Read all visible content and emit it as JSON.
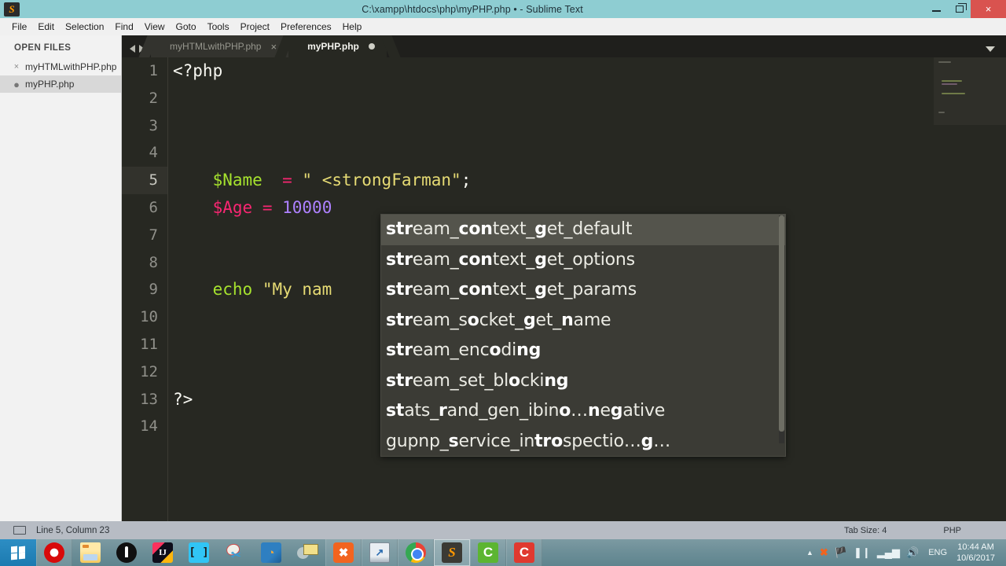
{
  "window": {
    "title": "C:\\xampp\\htdocs\\php\\myPHP.php • - Sublime Text",
    "app_icon": "S",
    "controls": {
      "minimize": "minimize-icon",
      "maximize": "restore-icon",
      "close": "×"
    }
  },
  "menubar": {
    "items": [
      "File",
      "Edit",
      "Selection",
      "Find",
      "View",
      "Goto",
      "Tools",
      "Project",
      "Preferences",
      "Help"
    ]
  },
  "sidebar": {
    "header": "OPEN FILES",
    "items": [
      {
        "label": "myHTMLwithPHP.php",
        "icon": "×",
        "active": false
      },
      {
        "label": "myPHP.php",
        "icon": "●",
        "active": true
      }
    ]
  },
  "tabs": {
    "nav_prev": "◀",
    "nav_next": "▶",
    "items": [
      {
        "label": "myHTMLwithPHP.php",
        "active": false,
        "dirty": false,
        "close": "×"
      },
      {
        "label": "myPHP.php",
        "active": true,
        "dirty": true
      }
    ],
    "overflow_menu": "chevron-down-icon"
  },
  "editor": {
    "line_numbers": [
      "1",
      "2",
      "3",
      "4",
      "5",
      "6",
      "7",
      "8",
      "9",
      "10",
      "11",
      "12",
      "13",
      "14"
    ],
    "current_line": 5,
    "lines": [
      {
        "n": 1,
        "tokens": [
          {
            "t": "<?php",
            "c": "tok-tag"
          }
        ]
      },
      {
        "n": 2,
        "tokens": []
      },
      {
        "n": 3,
        "tokens": []
      },
      {
        "n": 4,
        "tokens": []
      },
      {
        "n": 5,
        "tokens": [
          {
            "t": "    ",
            "c": "tok-punc"
          },
          {
            "t": "$Name",
            "c": "tok-var"
          },
          {
            "t": "  ",
            "c": "tok-punc"
          },
          {
            "t": "=",
            "c": "tok-op"
          },
          {
            "t": " ",
            "c": "tok-punc"
          },
          {
            "t": "\" <strongFarman\"",
            "c": "tok-str"
          },
          {
            "t": ";",
            "c": "tok-punc"
          }
        ]
      },
      {
        "n": 6,
        "tokens": [
          {
            "t": "    ",
            "c": "tok-punc"
          },
          {
            "t": "$Age",
            "c": "tok-var2"
          },
          {
            "t": " ",
            "c": "tok-punc"
          },
          {
            "t": "=",
            "c": "tok-op"
          },
          {
            "t": " ",
            "c": "tok-punc"
          },
          {
            "t": "10000",
            "c": "tok-num"
          }
        ]
      },
      {
        "n": 7,
        "tokens": []
      },
      {
        "n": 8,
        "tokens": []
      },
      {
        "n": 9,
        "tokens": [
          {
            "t": "    ",
            "c": "tok-punc"
          },
          {
            "t": "echo",
            "c": "tok-kw"
          },
          {
            "t": " ",
            "c": "tok-punc"
          },
          {
            "t": "\"My nam",
            "c": "tok-str"
          }
        ]
      },
      {
        "n": 10,
        "tokens": []
      },
      {
        "n": 11,
        "tokens": []
      },
      {
        "n": 12,
        "tokens": []
      },
      {
        "n": 13,
        "tokens": [
          {
            "t": "?>",
            "c": "tok-tag"
          }
        ]
      },
      {
        "n": 14,
        "tokens": []
      }
    ]
  },
  "autocomplete": {
    "selected_index": 0,
    "items": [
      {
        "parts": [
          {
            "t": "str",
            "b": true
          },
          {
            "t": "eam_",
            "b": false
          },
          {
            "t": "c",
            "b": true
          },
          {
            "t": "",
            "b": false
          },
          {
            "t": "on",
            "b": true
          },
          {
            "t": "text_",
            "b": false
          },
          {
            "t": "g",
            "b": true
          },
          {
            "t": "et_default",
            "b": false
          }
        ]
      },
      {
        "parts": [
          {
            "t": "str",
            "b": true
          },
          {
            "t": "eam_",
            "b": false
          },
          {
            "t": "c",
            "b": true
          },
          {
            "t": "",
            "b": false
          },
          {
            "t": "on",
            "b": true
          },
          {
            "t": "text_",
            "b": false
          },
          {
            "t": "g",
            "b": true
          },
          {
            "t": "et_options",
            "b": false
          }
        ]
      },
      {
        "parts": [
          {
            "t": "str",
            "b": true
          },
          {
            "t": "eam_",
            "b": false
          },
          {
            "t": "c",
            "b": true
          },
          {
            "t": "",
            "b": false
          },
          {
            "t": "on",
            "b": true
          },
          {
            "t": "text_",
            "b": false
          },
          {
            "t": "g",
            "b": true
          },
          {
            "t": "et_params",
            "b": false
          }
        ]
      },
      {
        "parts": [
          {
            "t": "str",
            "b": true
          },
          {
            "t": "eam_s",
            "b": false
          },
          {
            "t": "o",
            "b": true
          },
          {
            "t": "cket_",
            "b": false
          },
          {
            "t": "g",
            "b": true
          },
          {
            "t": "et_",
            "b": false
          },
          {
            "t": "n",
            "b": true
          },
          {
            "t": "ame",
            "b": false
          }
        ]
      },
      {
        "parts": [
          {
            "t": "str",
            "b": true
          },
          {
            "t": "eam_enc",
            "b": false
          },
          {
            "t": "o",
            "b": true
          },
          {
            "t": "di",
            "b": false
          },
          {
            "t": "ng",
            "b": true
          }
        ]
      },
      {
        "parts": [
          {
            "t": "str",
            "b": true
          },
          {
            "t": "eam_set_bl",
            "b": false
          },
          {
            "t": "o",
            "b": true
          },
          {
            "t": "cki",
            "b": false
          },
          {
            "t": "ng",
            "b": true
          }
        ]
      },
      {
        "parts": [
          {
            "t": "st",
            "b": true
          },
          {
            "t": "ats_",
            "b": false
          },
          {
            "t": "r",
            "b": true
          },
          {
            "t": "and_gen_ibin",
            "b": false
          },
          {
            "t": "o",
            "b": true
          },
          {
            "t": "…",
            "b": false
          },
          {
            "t": "n",
            "b": true
          },
          {
            "t": "e",
            "b": false
          },
          {
            "t": "g",
            "b": true
          },
          {
            "t": "ative",
            "b": false
          }
        ]
      },
      {
        "parts": [
          {
            "t": "gupnp_",
            "b": false
          },
          {
            "t": "s",
            "b": true
          },
          {
            "t": "ervice_in",
            "b": false
          },
          {
            "t": "tro",
            "b": true
          },
          {
            "t": "spectio…",
            "b": false
          },
          {
            "t": "g",
            "b": true
          },
          {
            "t": "…",
            "b": false
          }
        ]
      }
    ]
  },
  "statusbar": {
    "cursor": "Line 5, Column 23",
    "tab_size": "Tab Size: 4",
    "syntax": "PHP",
    "left_icon": "panel-icon"
  },
  "taskbar": {
    "start_icon": "windows-logo-icon",
    "apps": [
      {
        "name": "opera",
        "icon_class": "ic-opera",
        "glyph": "",
        "state": "open"
      },
      {
        "name": "file-explorer",
        "icon_class": "ic-folder",
        "glyph": "",
        "state": ""
      },
      {
        "name": "pen-tool",
        "icon_class": "ic-black",
        "glyph": "",
        "state": ""
      },
      {
        "name": "intellij-idea",
        "icon_class": "ic-ij",
        "glyph": "IJ",
        "state": ""
      },
      {
        "name": "brackets-editor",
        "icon_class": "ic-brackets",
        "glyph": "",
        "state": ""
      },
      {
        "name": "snipping-tool",
        "icon_class": "ic-snip",
        "glyph": "",
        "state": ""
      },
      {
        "name": "vmware",
        "icon_class": "ic-vm",
        "glyph": "",
        "state": ""
      },
      {
        "name": "mail-search",
        "icon_class": "ic-mail",
        "glyph": "",
        "state": ""
      },
      {
        "name": "xampp-control-panel",
        "icon_class": "ic-xampp",
        "glyph": "✖",
        "state": "open"
      },
      {
        "name": "performance-monitor",
        "icon_class": "ic-perf",
        "glyph": "",
        "state": "open"
      },
      {
        "name": "google-chrome",
        "icon_class": "ic-chrome",
        "glyph": "",
        "state": "open"
      },
      {
        "name": "sublime-text",
        "icon_class": "ic-sublime",
        "glyph": "S",
        "state": "active"
      },
      {
        "name": "camtasia-studio",
        "icon_class": "ic-camt-g",
        "glyph": "C",
        "state": "open"
      },
      {
        "name": "camtasia-recorder",
        "icon_class": "ic-camt-r",
        "glyph": "C",
        "state": "open"
      }
    ],
    "tray": {
      "show_hidden": "▲",
      "icons": [
        "xampp-tray-icon",
        "network-disconnected-icon",
        "battery-icon",
        "signal-icon",
        "volume-icon"
      ],
      "language": "ENG",
      "time": "10:44 AM",
      "date": "10/6/2017"
    }
  }
}
